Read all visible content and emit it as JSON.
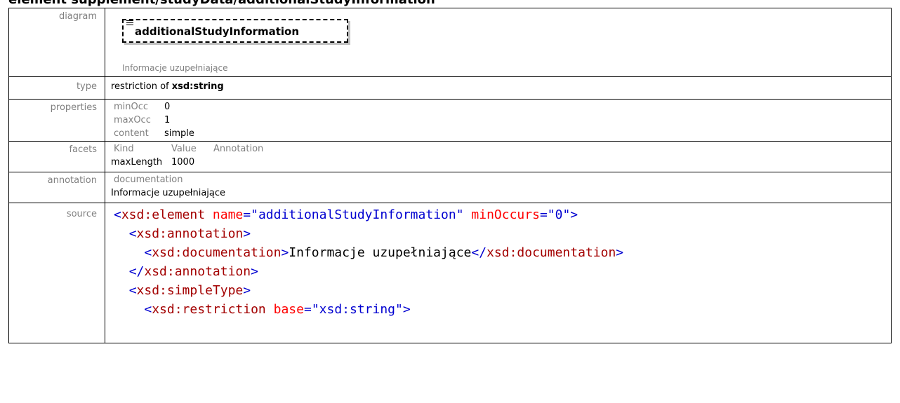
{
  "page_title": "element supplement/studyData/additionalStudyInformation",
  "rows": {
    "diagram": {
      "label": "diagram",
      "element_name": "additionalStudyInformation",
      "doc": "Informacje uzupełniające"
    },
    "type": {
      "label": "type",
      "prefix": "restriction of ",
      "base": "xsd:string"
    },
    "properties": {
      "label": "properties",
      "items": [
        {
          "key": "minOcc",
          "value": "0"
        },
        {
          "key": "maxOcc",
          "value": "1"
        },
        {
          "key": "content",
          "value": "simple"
        }
      ]
    },
    "facets": {
      "label": "facets",
      "headers": [
        "Kind",
        "Value",
        "Annotation"
      ],
      "row": {
        "kind": "maxLength",
        "value": "1000",
        "annotation": ""
      }
    },
    "annotation": {
      "label": "annotation",
      "header": "documentation",
      "text": "Informacje uzupełniające"
    },
    "source": {
      "label": "source",
      "lines": [
        "<xsd:element name=\"additionalStudyInformation\" minOccurs=\"0\">",
        "  <xsd:annotation>",
        "    <xsd:documentation>Informacje uzupełniające</xsd:documentation>",
        "  </xsd:annotation>",
        "  <xsd:simpleType>",
        "    <xsd:restriction base=\"xsd:string\">"
      ]
    }
  },
  "colors": {
    "tag_bracket": "#0000d0",
    "tag_name": "#a30000",
    "attr_name": "#ff0000",
    "attr_value": "#0000d0",
    "label_gray": "#808080"
  }
}
